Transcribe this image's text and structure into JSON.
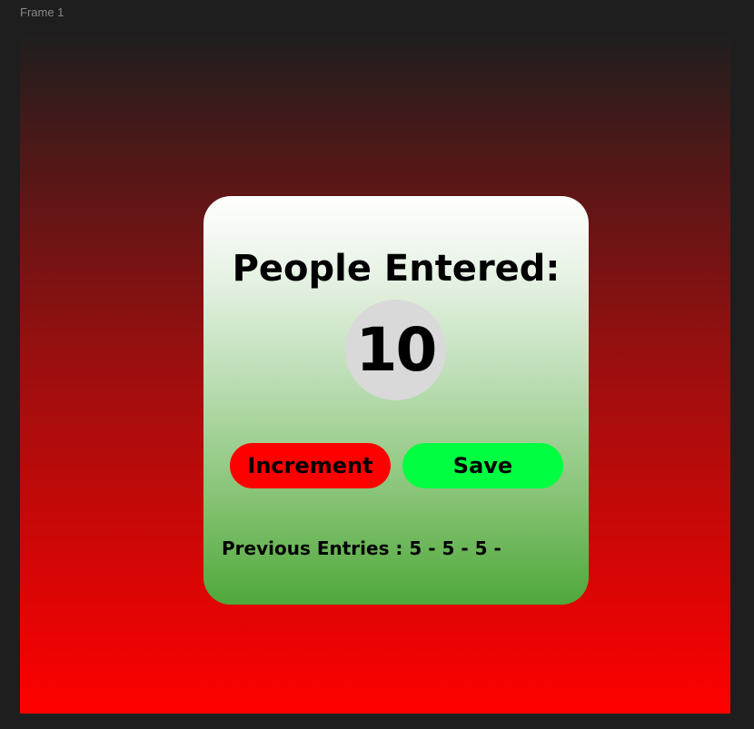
{
  "frame": {
    "label": "Frame 1"
  },
  "card": {
    "title": "People Entered:",
    "count": "10",
    "increment_label": "Increment",
    "save_label": "Save",
    "previous_entries": "Previous Entries : 5 - 5 - 5 -"
  },
  "colors": {
    "canvas": "#1e1e1e",
    "frame_gradient_top": "#1e1e1e",
    "frame_gradient_bottom": "#ff0000",
    "card_gradient_top": "#ffffff",
    "card_gradient_bottom": "#4ea83a",
    "counter_circle": "#d9d9d9",
    "increment_button": "#ff0000",
    "save_button": "#00ff41"
  }
}
